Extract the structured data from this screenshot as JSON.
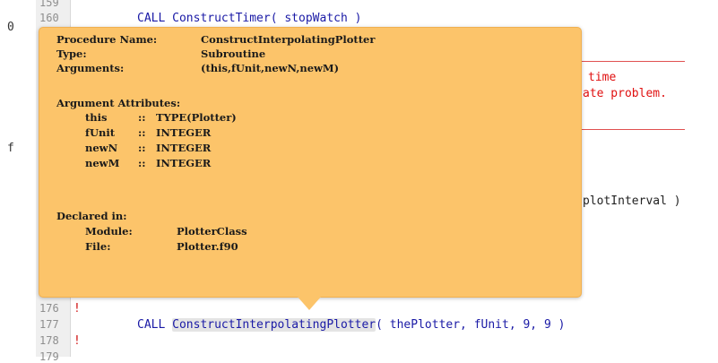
{
  "editor": {
    "left_glyphs": [
      "0",
      "f"
    ],
    "line_numbers": [
      "159",
      "160",
      "176",
      "177",
      "178",
      "179"
    ],
    "line_160_code": "CALL ConstructTimer( stopWatch )",
    "comment_frag_1": "time",
    "comment_frag_2": "ate problem.",
    "code_frag": "plotInterval )",
    "line_177_call": "CALL ",
    "line_177_proc": "ConstructInterpolatingPlotter",
    "line_177_args": "( thePlotter, fUnit, 9, 9 )",
    "bang": "!"
  },
  "tooltip": {
    "procedure_name_label": "Procedure Name:",
    "procedure_name_value": "ConstructInterpolatingPlotter",
    "type_label": "Type:",
    "type_value": "Subroutine",
    "arguments_label": "Arguments:",
    "arguments_value": "(this,fUnit,newN,newM)",
    "argument_attributes_heading": "Argument Attributes:",
    "attributes": [
      {
        "name": "this",
        "sep": "::",
        "type": "TYPE(Plotter)"
      },
      {
        "name": "fUnit",
        "sep": "::",
        "type": "INTEGER"
      },
      {
        "name": "newN",
        "sep": "::",
        "type": "INTEGER"
      },
      {
        "name": "newM",
        "sep": "::",
        "type": "INTEGER"
      }
    ],
    "declared_in_heading": "Declared in:",
    "module_label": "Module:",
    "module_value": "PlotterClass",
    "file_label": "File:",
    "file_value": "Plotter.f90"
  },
  "colors": {
    "tooltip_bg": "#fcc46a",
    "keyword_blue": "#1a1aa6",
    "error_red": "#e01010"
  }
}
